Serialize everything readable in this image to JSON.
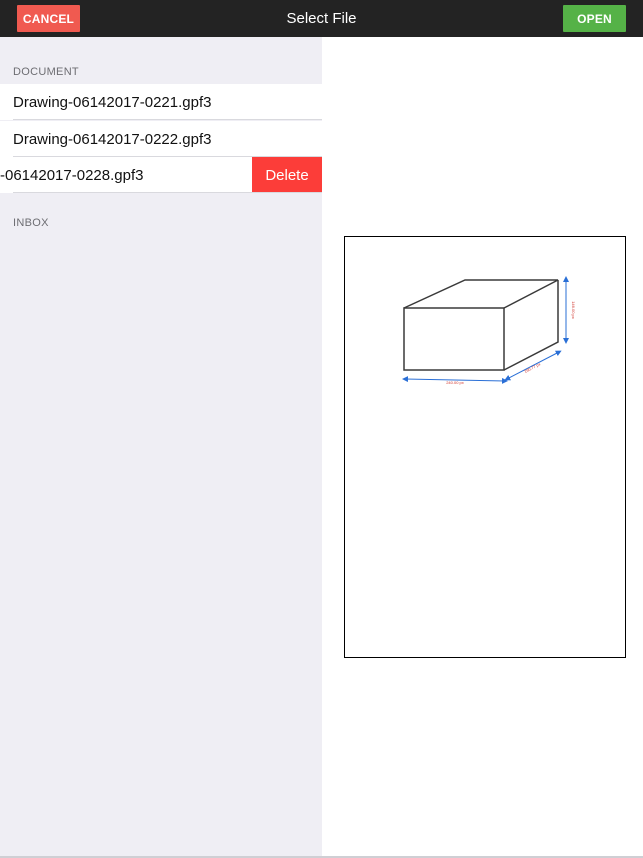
{
  "header": {
    "title": "Select File",
    "cancel_label": "CANCEL",
    "open_label": "OPEN",
    "cancel_color": "#f05a50",
    "open_color": "#55b247"
  },
  "document_section": {
    "header": "DOCUMENT",
    "files": [
      {
        "name": "Drawing-06142017-0221.gpf3"
      },
      {
        "name": "Drawing-06142017-0222.gpf3"
      },
      {
        "name": "-06142017-0228.gpf3",
        "swiped": true
      }
    ],
    "delete_label": "Delete",
    "delete_color": "#fc3d39"
  },
  "inbox_section": {
    "header": "INBOX"
  },
  "preview": {
    "dimensions": {
      "width": "240.00 px",
      "depth": "160.77 px",
      "height": "146.00 px"
    }
  }
}
